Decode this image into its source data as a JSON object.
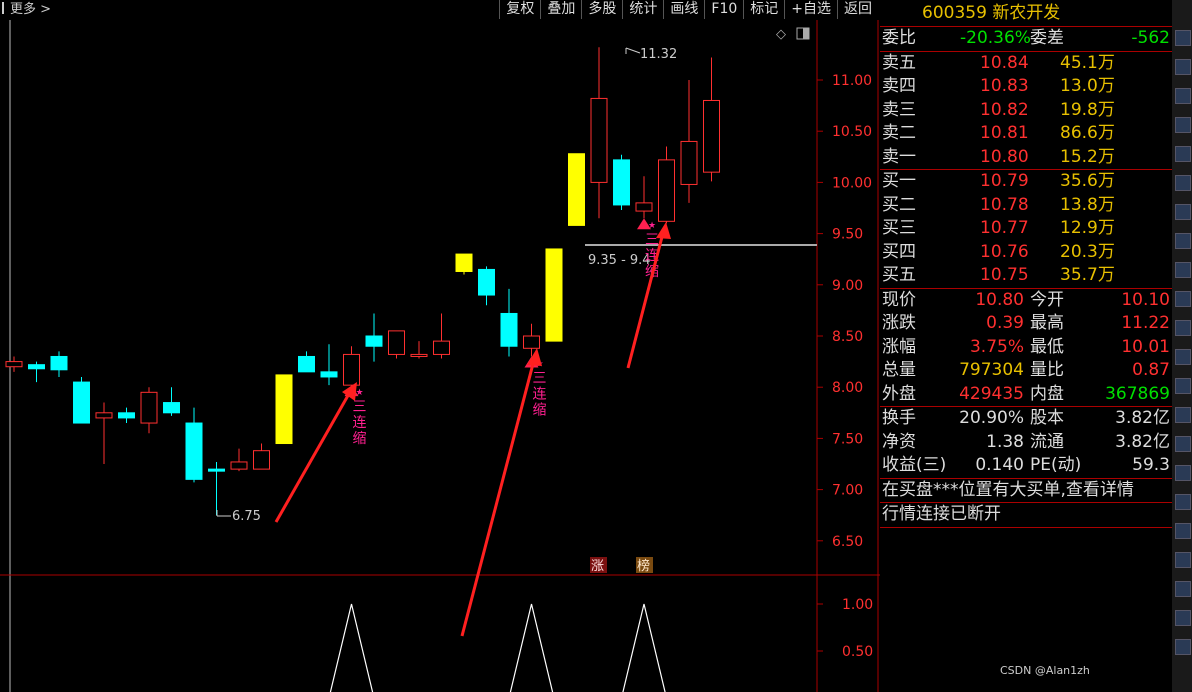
{
  "toolbar": {
    "more_label": "更多 >",
    "buttons": [
      "复权",
      "叠加",
      "多股",
      "统计",
      "画线",
      "F10",
      "标记",
      "+自选",
      "返回"
    ]
  },
  "chart": {
    "high_label": "11.32",
    "low_label": "6.75",
    "range_label": "9.35 - 9.4",
    "annotation": "三连缩",
    "badge1": "涨",
    "badge2": "榜",
    "y_ticks": [
      "11.00",
      "10.50",
      "10.00",
      "9.50",
      "9.00",
      "8.50",
      "8.00",
      "7.50",
      "7.00",
      "6.50"
    ],
    "sub_ticks": [
      "1.00",
      "0.50"
    ]
  },
  "chart_data": {
    "type": "candlestick",
    "yrange": [
      6.3,
      11.6
    ],
    "y_ticks": [
      11.0,
      10.5,
      10.0,
      9.5,
      9.0,
      8.5,
      8.0,
      7.5,
      7.0,
      6.5
    ],
    "candles": [
      {
        "o": 8.2,
        "c": 8.25,
        "h": 8.3,
        "l": 8.15,
        "col": "r"
      },
      {
        "o": 8.22,
        "c": 8.18,
        "h": 8.25,
        "l": 8.05,
        "col": "c"
      },
      {
        "o": 8.3,
        "c": 8.17,
        "h": 8.35,
        "l": 8.1,
        "col": "c"
      },
      {
        "o": 8.05,
        "c": 7.65,
        "h": 8.1,
        "l": 7.65,
        "col": "c"
      },
      {
        "o": 7.7,
        "c": 7.75,
        "h": 7.85,
        "l": 7.25,
        "col": "r"
      },
      {
        "o": 7.75,
        "c": 7.7,
        "h": 7.8,
        "l": 7.65,
        "col": "c"
      },
      {
        "o": 7.65,
        "c": 7.95,
        "h": 8.0,
        "l": 7.55,
        "col": "r"
      },
      {
        "o": 7.85,
        "c": 7.75,
        "h": 8.0,
        "l": 7.72,
        "col": "c"
      },
      {
        "o": 7.65,
        "c": 7.1,
        "h": 7.8,
        "l": 7.07,
        "col": "c"
      },
      {
        "o": 7.2,
        "c": 7.18,
        "h": 7.27,
        "l": 6.75,
        "col": "c"
      },
      {
        "o": 7.2,
        "c": 7.27,
        "h": 7.4,
        "l": 7.18,
        "col": "r"
      },
      {
        "o": 7.2,
        "c": 7.38,
        "h": 7.45,
        "l": 7.2,
        "col": "r"
      },
      {
        "o": 7.45,
        "c": 8.12,
        "h": 8.12,
        "l": 7.45,
        "col": "y"
      },
      {
        "o": 8.3,
        "c": 8.15,
        "h": 8.35,
        "l": 8.15,
        "col": "c"
      },
      {
        "o": 8.15,
        "c": 8.1,
        "h": 8.42,
        "l": 8.02,
        "col": "c"
      },
      {
        "o": 8.02,
        "c": 8.32,
        "h": 8.4,
        "l": 8.02,
        "col": "r"
      },
      {
        "o": 8.5,
        "c": 8.4,
        "h": 8.72,
        "l": 8.25,
        "col": "c"
      },
      {
        "o": 8.32,
        "c": 8.55,
        "h": 8.55,
        "l": 8.28,
        "col": "r"
      },
      {
        "o": 8.3,
        "c": 8.32,
        "h": 8.45,
        "l": 8.28,
        "col": "r"
      },
      {
        "o": 8.32,
        "c": 8.45,
        "h": 8.72,
        "l": 8.28,
        "col": "r"
      },
      {
        "o": 9.3,
        "c": 9.13,
        "h": 9.3,
        "l": 9.1,
        "col": "y"
      },
      {
        "o": 9.15,
        "c": 8.9,
        "h": 9.18,
        "l": 8.8,
        "col": "c"
      },
      {
        "o": 8.72,
        "c": 8.4,
        "h": 8.96,
        "l": 8.3,
        "col": "c"
      },
      {
        "o": 8.38,
        "c": 8.5,
        "h": 8.62,
        "l": 8.3,
        "col": "r"
      },
      {
        "o": 8.45,
        "c": 9.35,
        "h": 9.35,
        "l": 8.45,
        "col": "y"
      },
      {
        "o": 9.58,
        "c": 10.28,
        "h": 10.28,
        "l": 9.58,
        "col": "y"
      },
      {
        "o": 10.0,
        "c": 10.82,
        "h": 11.32,
        "l": 9.65,
        "col": "r"
      },
      {
        "o": 10.22,
        "c": 9.78,
        "h": 10.27,
        "l": 9.73,
        "col": "c"
      },
      {
        "o": 9.72,
        "c": 9.8,
        "h": 10.06,
        "l": 9.65,
        "col": "r"
      },
      {
        "o": 9.62,
        "c": 10.22,
        "h": 10.35,
        "l": 9.6,
        "col": "r"
      },
      {
        "o": 9.98,
        "c": 10.4,
        "h": 11.0,
        "l": 9.8,
        "col": "r"
      },
      {
        "o": 10.1,
        "c": 10.8,
        "h": 11.22,
        "l": 10.01,
        "col": "r"
      }
    ],
    "signals": [
      15,
      23,
      28
    ],
    "sub_series": [
      0,
      0,
      0,
      0,
      0,
      0,
      0,
      0,
      0,
      0,
      0,
      0,
      0,
      0,
      0,
      1,
      0,
      0,
      0,
      0,
      0,
      0,
      0,
      1,
      0,
      0,
      0,
      0,
      1,
      0,
      0,
      0
    ]
  },
  "panel": {
    "code": "600359",
    "name": "新农开发",
    "webi_label": "委比",
    "webi_value": "-20.36%",
    "weicha_label": "委差",
    "weicha_value": "-562",
    "sell": [
      {
        "label": "卖五",
        "price": "10.84",
        "vol": "45.1万"
      },
      {
        "label": "卖四",
        "price": "10.83",
        "vol": "13.0万"
      },
      {
        "label": "卖三",
        "price": "10.82",
        "vol": "19.8万"
      },
      {
        "label": "卖二",
        "price": "10.81",
        "vol": "86.6万"
      },
      {
        "label": "卖一",
        "price": "10.80",
        "vol": "15.2万"
      }
    ],
    "buy": [
      {
        "label": "买一",
        "price": "10.79",
        "vol": "35.6万"
      },
      {
        "label": "买二",
        "price": "10.78",
        "vol": "13.8万"
      },
      {
        "label": "买三",
        "price": "10.77",
        "vol": "12.9万"
      },
      {
        "label": "买四",
        "price": "10.76",
        "vol": "20.3万"
      },
      {
        "label": "买五",
        "price": "10.75",
        "vol": "35.7万"
      }
    ],
    "stats": [
      {
        "l1": "现价",
        "v1": "10.80",
        "c1": "red",
        "l2": "今开",
        "v2": "10.10",
        "c2": "red"
      },
      {
        "l1": "涨跌",
        "v1": "0.39",
        "c1": "red",
        "l2": "最高",
        "v2": "11.22",
        "c2": "red"
      },
      {
        "l1": "涨幅",
        "v1": "3.75%",
        "c1": "red",
        "l2": "最低",
        "v2": "10.01",
        "c2": "red"
      },
      {
        "l1": "总量",
        "v1": "797304",
        "c1": "yel",
        "l2": "量比",
        "v2": "0.87",
        "c2": "red"
      },
      {
        "l1": "外盘",
        "v1": "429435",
        "c1": "red",
        "l2": "内盘",
        "v2": "367869",
        "c2": "grn"
      }
    ],
    "stats2": [
      {
        "l1": "换手",
        "v1": "20.90%",
        "l2": "股本",
        "v2": "3.82亿"
      },
      {
        "l1": "净资",
        "v1": "1.38",
        "l2": "流通",
        "v2": "3.82亿"
      },
      {
        "l1": "收益(三)",
        "v1": "0.140",
        "l2": "PE(动)",
        "v2": "59.3"
      }
    ],
    "msg1": "在买盘***位置有大买单,查看详情",
    "msg2": "行情连接已断开"
  },
  "watermark": "CSDN @Alan1zh"
}
